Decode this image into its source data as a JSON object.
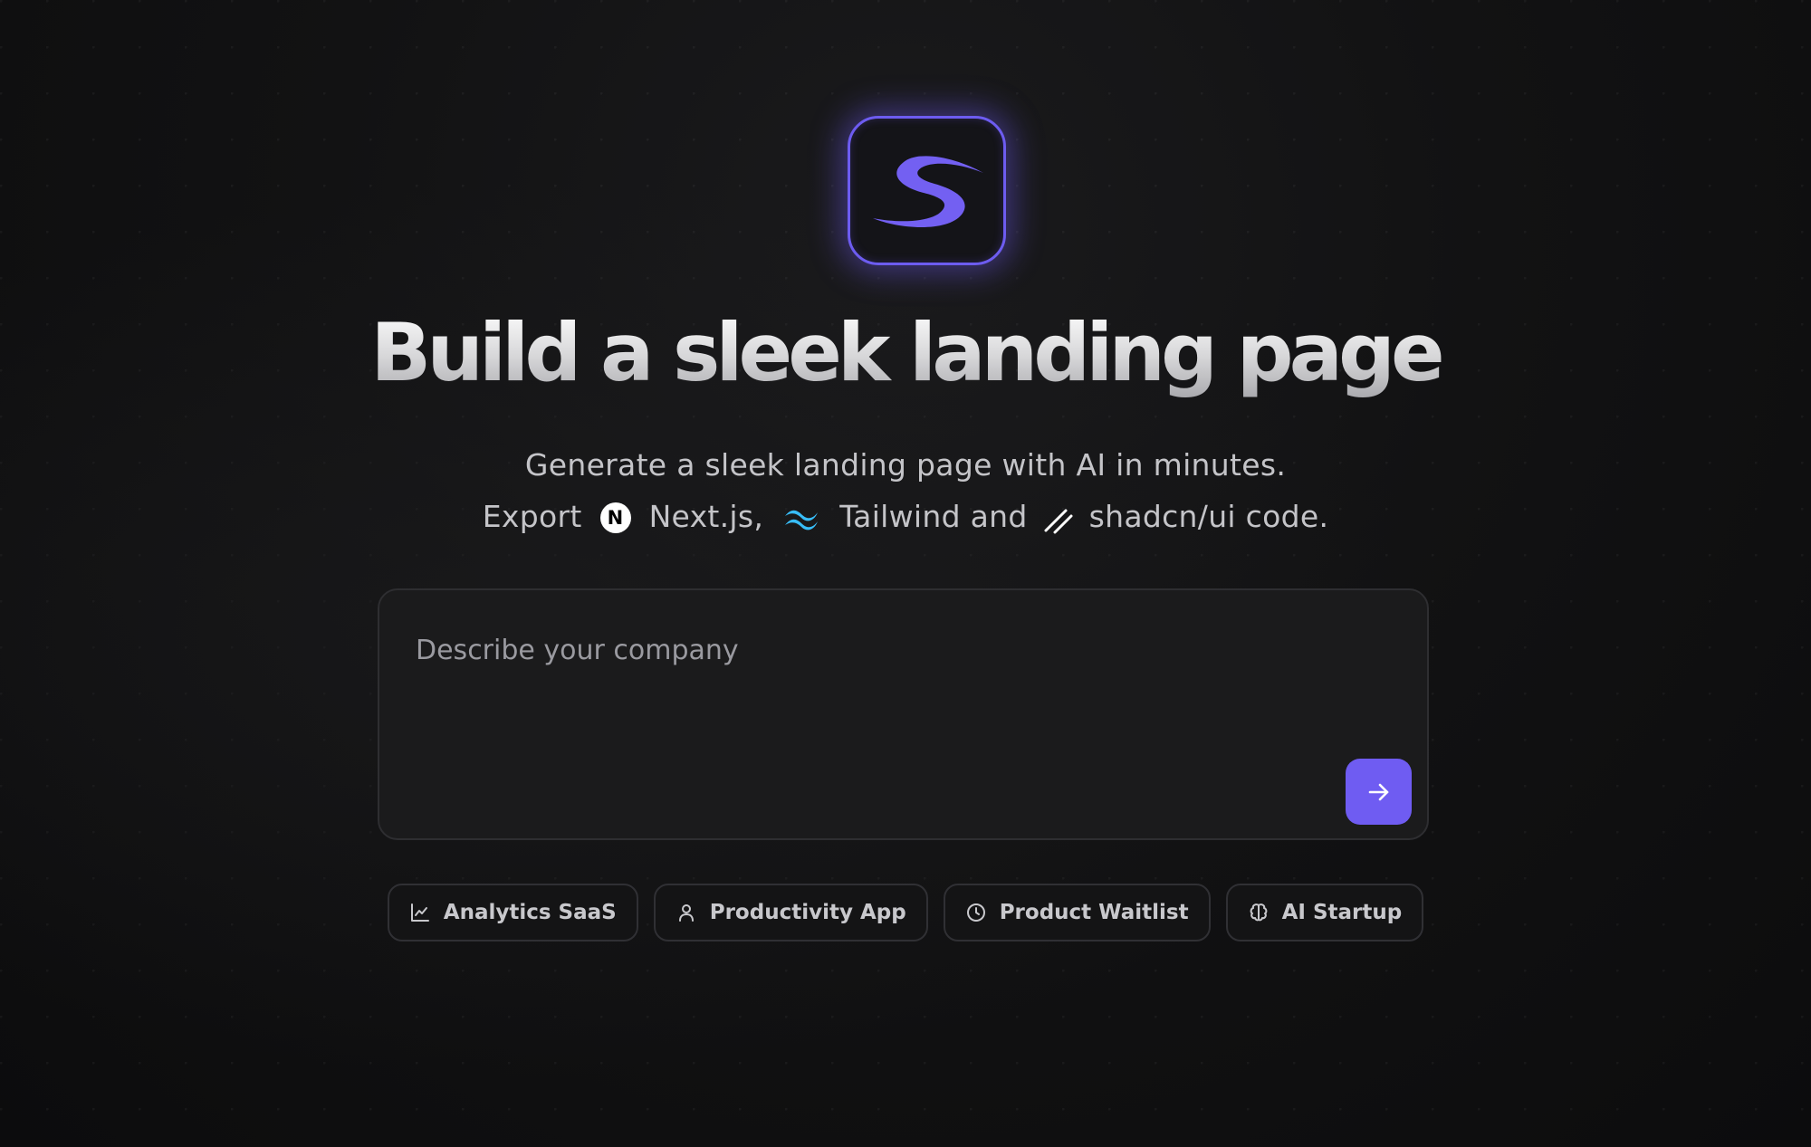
{
  "hero": {
    "headline": "Build a sleek landing page",
    "subtitle_line1": "Generate a sleek landing page with AI in minutes.",
    "subtitle_line2": {
      "export_label": "Export",
      "nextjs_label": "Next.js,",
      "nextjs_icon_letter": "N",
      "tailwind_label": "Tailwind and",
      "shadcn_label": "shadcn/ui code."
    }
  },
  "prompt": {
    "placeholder": "Describe your company",
    "value": ""
  },
  "suggestions": [
    {
      "label": "Analytics SaaS",
      "icon": "line-chart-icon"
    },
    {
      "label": "Productivity App",
      "icon": "user-icon"
    },
    {
      "label": "Product Waitlist",
      "icon": "clock-icon"
    },
    {
      "label": "AI Startup",
      "icon": "brain-icon"
    }
  ],
  "colors": {
    "accent": "#6f5cf2",
    "background": "#0f0f10",
    "card": "#1b1b1c",
    "tailwind": "#38bdf8"
  }
}
